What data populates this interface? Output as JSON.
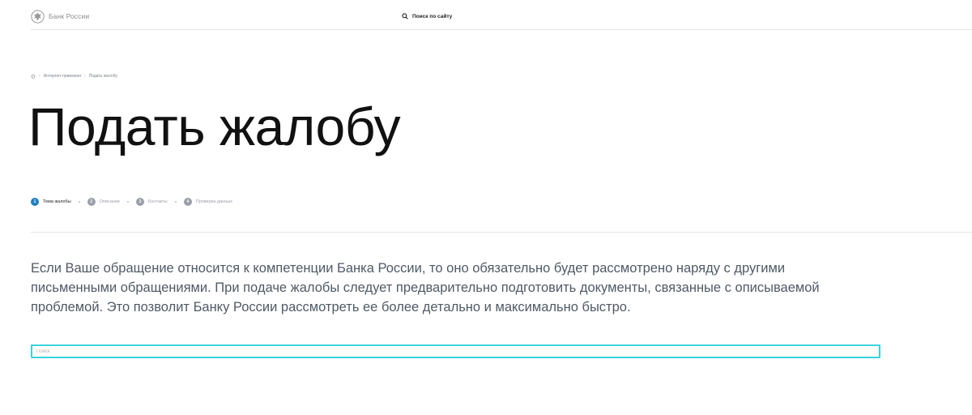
{
  "header": {
    "logo_text": "Банк России",
    "search_label": "Поиск по сайту"
  },
  "breadcrumb": {
    "items": [
      "Интернет-приемная",
      "Подать жалобу"
    ]
  },
  "page": {
    "title": "Подать жалобу",
    "intro": "Если Ваше обращение относится к компетенции Банка России, то оно обязательно будет рассмотрено наряду с другими письменными обращениями. При подаче жалобы следует предварительно подготовить документы, связанные с описываемой проблемой. Это позволит Банку России рассмотреть ее более детально и максимально быстро."
  },
  "steps": [
    {
      "number": "1",
      "label": "Тема жалобы",
      "active": true
    },
    {
      "number": "2",
      "label": "Описание",
      "active": false
    },
    {
      "number": "3",
      "label": "Контакты",
      "active": false
    },
    {
      "number": "4",
      "label": "Проверка данных",
      "active": false
    }
  ],
  "search": {
    "placeholder": "Поиск",
    "value": ""
  },
  "colors": {
    "accent": "#1f7fc1",
    "focus_border": "#3ad3dc",
    "text": "#4f5a66"
  },
  "icons": {
    "logo": "bank-of-russia-emblem-icon",
    "search": "search-icon",
    "home": "home-icon"
  }
}
